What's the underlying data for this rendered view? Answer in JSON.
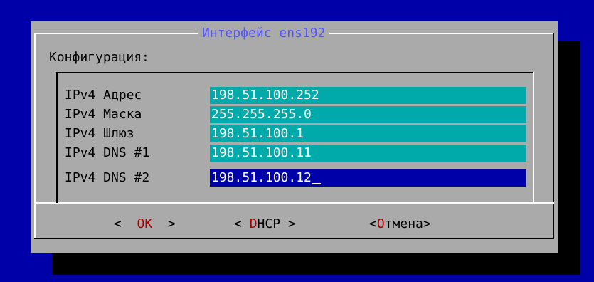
{
  "dialog": {
    "title": "Интерфейс ens192",
    "section_label": "Конфигурация:"
  },
  "fields": [
    {
      "label": "IPv4 Адрес",
      "value": "198.51.100.252",
      "active": false
    },
    {
      "label": "IPv4 Маска",
      "value": "255.255.255.0",
      "active": false
    },
    {
      "label": "IPv4 Шлюз",
      "value": "198.51.100.1",
      "active": false
    },
    {
      "label": "IPv4 DNS #1",
      "value": "198.51.100.11",
      "active": false
    },
    {
      "label": "IPv4 DNS #2",
      "value": "198.51.100.12",
      "active": true
    }
  ],
  "buttons": {
    "ok": {
      "left": "<  ",
      "hotkey": "O",
      "rest": "K",
      "right": "  >"
    },
    "dhcp": {
      "left": "< ",
      "hotkey": "D",
      "rest": "HCP",
      "right": " >"
    },
    "cancel": {
      "left": "<",
      "hotkey": "О",
      "rest": "тмена",
      "right": ">"
    }
  },
  "colors": {
    "background": "#0000a8",
    "dialog": "#aaaaaa",
    "title": "#5555ff",
    "field": "#00aaaa",
    "field_active": "#0000a8",
    "hotkey": "#aa0000"
  }
}
